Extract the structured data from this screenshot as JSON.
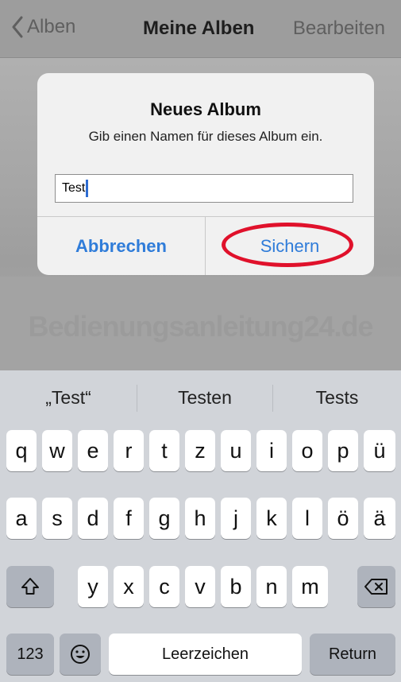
{
  "nav": {
    "back_label": "Alben",
    "title": "Meine Alben",
    "edit_label": "Bearbeiten"
  },
  "watermark": "Bedienungsanleitung24.de",
  "alert": {
    "title": "Neues Album",
    "message": "Gib einen Namen für dieses Album ein.",
    "input_value": "Test",
    "cancel_label": "Abbrechen",
    "save_label": "Sichern",
    "highlight_color": "#e0112b"
  },
  "keyboard": {
    "suggestions": [
      "„Test“",
      "Testen",
      "Tests"
    ],
    "row1": [
      "q",
      "w",
      "e",
      "r",
      "t",
      "z",
      "u",
      "i",
      "o",
      "p",
      "ü"
    ],
    "row2": [
      "a",
      "s",
      "d",
      "f",
      "g",
      "h",
      "j",
      "k",
      "l",
      "ö",
      "ä"
    ],
    "row3": [
      "y",
      "x",
      "c",
      "v",
      "b",
      "n",
      "m"
    ],
    "numbers_label": "123",
    "space_label": "Leerzeichen",
    "return_label": "Return",
    "icons": [
      "shift-icon",
      "backspace-icon",
      "emoji-icon"
    ]
  },
  "colors": {
    "accent": "#2f7cd9",
    "keyboard_bg": "#d1d4d9"
  }
}
